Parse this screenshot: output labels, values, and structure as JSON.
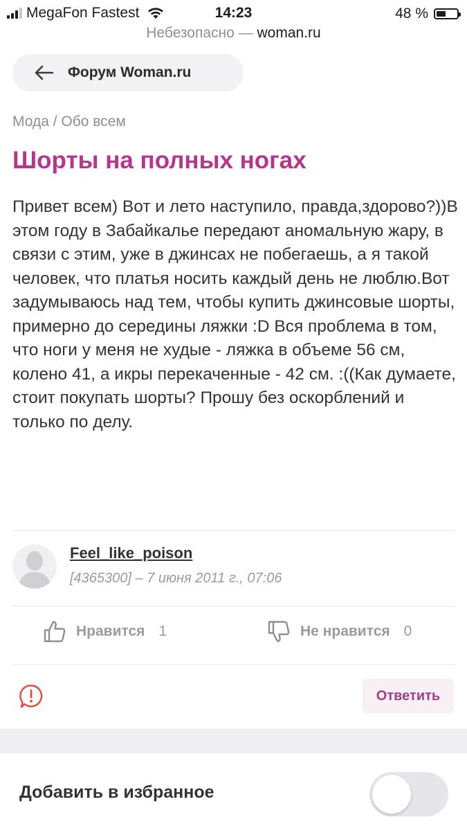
{
  "status_bar": {
    "carrier": "MegaFon Fastest",
    "time": "14:23",
    "battery_percent": "48 %",
    "battery_level": 0.48
  },
  "url_bar": {
    "security": "Небезопасно — ",
    "domain": "woman.ru"
  },
  "nav": {
    "back_label": "Форум Woman.ru"
  },
  "breadcrumb": "Мода / Обо всем",
  "post": {
    "title": "Шорты на полных ногах",
    "body": "Привет всем) Вот и лето наступило, правда,здорово?))В этом году в Забайкалье передают аномальную жару, в связи с этим, уже в джинсах не побегаешь, а я такой человек, что платья носить каждый день не люблю.Вот задумываюсь над тем, чтобы купить джинсовые шорты, примерно до середины ляжки :D Вся проблема в том, что ноги у меня не худые - ляжка в объеме 56 см, колено 41, а икры перекаченные - 42 см. :((Как думаете, стоит покупать шорты? Прошу без оскорблений и только по делу."
  },
  "author": {
    "name": "Feel_like_poison",
    "meta": "[4365300] – 7 июня 2011 г., 07:06"
  },
  "votes": {
    "like_label": "Нравится",
    "like_count": "1",
    "dislike_label": "Не нравится",
    "dislike_count": "0"
  },
  "actions": {
    "reply_label": "Ответить"
  },
  "favorites": {
    "label": "Добавить в избранное",
    "enabled": false
  },
  "colors": {
    "title": "#b7358a",
    "reply_text": "#a23e86",
    "alert": "#e8473f"
  }
}
